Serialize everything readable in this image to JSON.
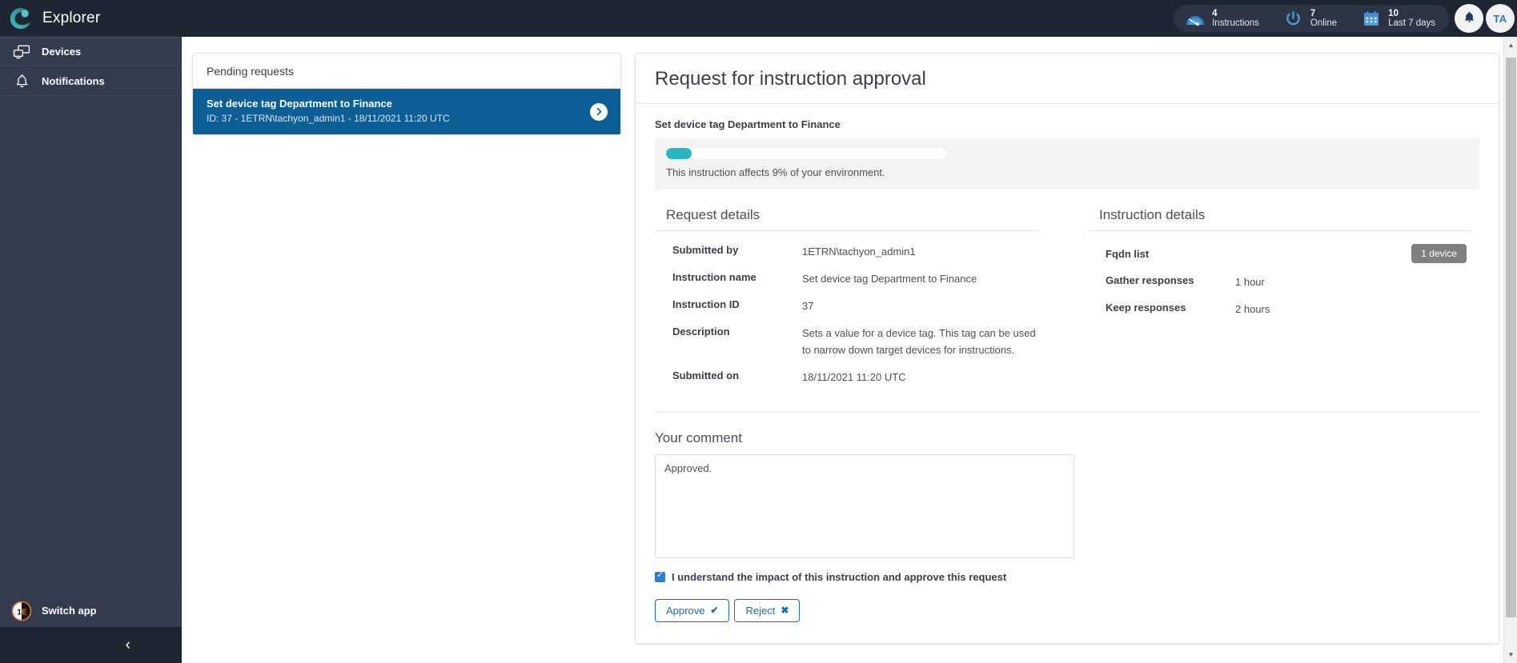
{
  "app": {
    "name": "Explorer",
    "logo_icon": "tachyon-logo-icon"
  },
  "header": {
    "stats": [
      {
        "icon": "gauge-icon",
        "number": "4",
        "label": "Instructions"
      },
      {
        "icon": "power-icon",
        "number": "7",
        "label": "Online"
      },
      {
        "icon": "calendar-icon",
        "number": "10",
        "label": "Last 7 days"
      }
    ],
    "bell_icon": "bell-icon",
    "avatar_initials": "TA"
  },
  "sidebar": {
    "items": [
      {
        "icon": "devices-icon",
        "label": "Devices"
      },
      {
        "icon": "bell-icon",
        "label": "Notifications"
      }
    ],
    "switch_app": {
      "icon": "one-e-logo-icon",
      "label": "Switch app"
    },
    "collapse_icon": "chevron-left-icon"
  },
  "pending": {
    "panel_title": "Pending requests",
    "requests": [
      {
        "title": "Set device tag Department to Finance",
        "meta": "ID: 37 - 1ETRN\\tachyon_admin1 - 18/11/2021 11:20 UTC",
        "chevron_icon": "chevron-right-icon"
      }
    ]
  },
  "detail": {
    "title": "Request for instruction approval",
    "instruction_name": "Set device tag Department to Finance",
    "impact": {
      "percent": 9,
      "text": "This instruction affects 9% of your environment."
    },
    "request_details": {
      "section_title": "Request details",
      "rows": [
        {
          "key": "Submitted by",
          "value": "1ETRN\\tachyon_admin1"
        },
        {
          "key": "Instruction name",
          "value": "Set device tag Department to Finance"
        },
        {
          "key": "Instruction ID",
          "value": "37"
        },
        {
          "key": "Description",
          "value": "Sets a value for a device tag. This tag can be used to narrow down target devices for instructions."
        },
        {
          "key": "Submitted on",
          "value": "18/11/2021 11:20 UTC"
        }
      ]
    },
    "instruction_details": {
      "section_title": "Instruction details",
      "fqdn_key": "Fqdn list",
      "fqdn_badge": "1 device",
      "rows": [
        {
          "key": "Gather responses",
          "value": "1 hour"
        },
        {
          "key": "Keep responses",
          "value": "2 hours"
        }
      ]
    },
    "comment": {
      "section_title": "Your comment",
      "value": "Approved.",
      "placeholder": "",
      "consent_label": "I understand the impact of this instruction and approve this request",
      "consent_checked": true,
      "approve_label": "Approve",
      "approve_icon": "check-icon",
      "reject_label": "Reject",
      "reject_icon": "cross-icon"
    }
  },
  "colors": {
    "topbar": "#1f2633",
    "sidebar": "#323c4e",
    "accent_blue": "#0d5e96",
    "progress_teal": "#25b7c4",
    "badge_gray": "#808080",
    "button_blue": "#1a6bb0"
  }
}
